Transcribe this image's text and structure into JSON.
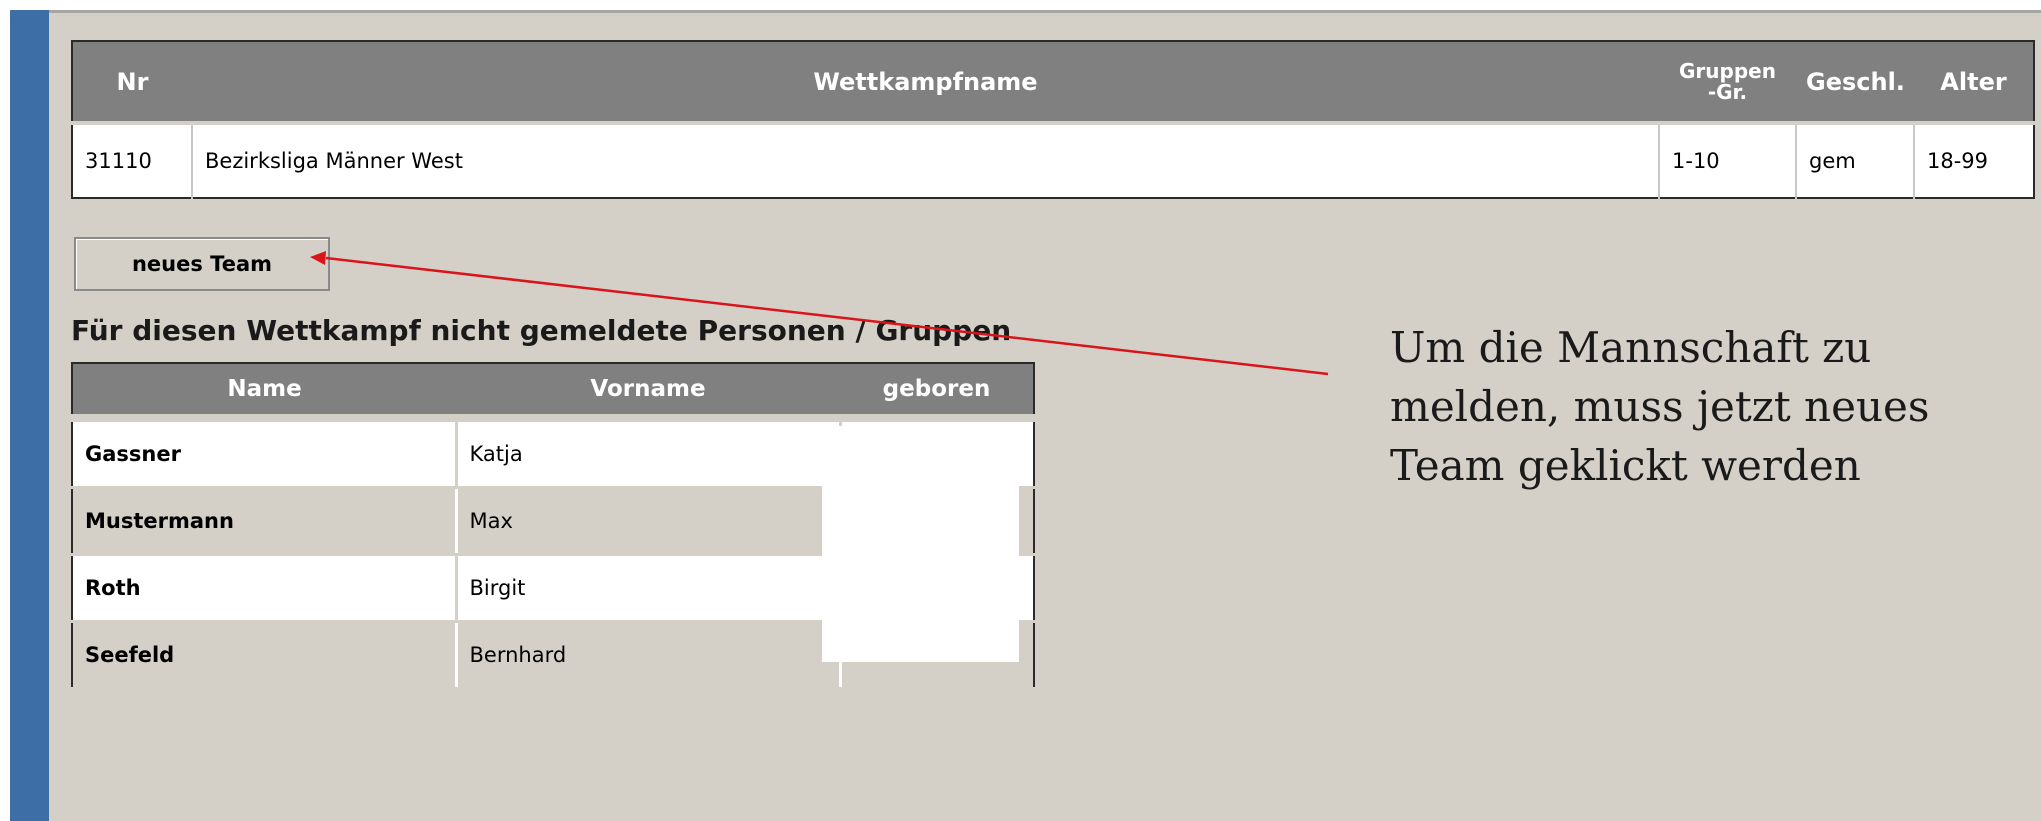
{
  "competition_table": {
    "headers": {
      "nr": "Nr",
      "name": "Wettkampfname",
      "group_size_line1": "Gruppen",
      "group_size_line2": "-Gr.",
      "gender": "Geschl.",
      "age": "Alter"
    },
    "row": {
      "nr": "31110",
      "name": "Bezirksliga Männer West",
      "group_size": "1-10",
      "gender": "gem",
      "age": "18-99"
    }
  },
  "new_team_button": "neues Team",
  "unregistered_heading": "Für diesen Wettkampf nicht gemeldete Personen / Gruppen",
  "persons_table": {
    "headers": {
      "last_name": "Name",
      "first_name": "Vorname",
      "born": "geboren"
    },
    "rows": [
      {
        "last_name": "Gassner",
        "first_name": "Katja",
        "born": ""
      },
      {
        "last_name": "Mustermann",
        "first_name": "Max",
        "born": ""
      },
      {
        "last_name": "Roth",
        "first_name": "Birgit",
        "born": ""
      },
      {
        "last_name": "Seefeld",
        "first_name": "Bernhard",
        "born": ""
      }
    ]
  },
  "annotation": {
    "text": "Um die Mannschaft zu melden, muss jetzt neues Team geklickt werden",
    "arrow_color": "#d9141b"
  },
  "colors": {
    "sidebar": "#3d6ea5",
    "panel_background": "#d4d0c8",
    "table_header": "#808080"
  }
}
